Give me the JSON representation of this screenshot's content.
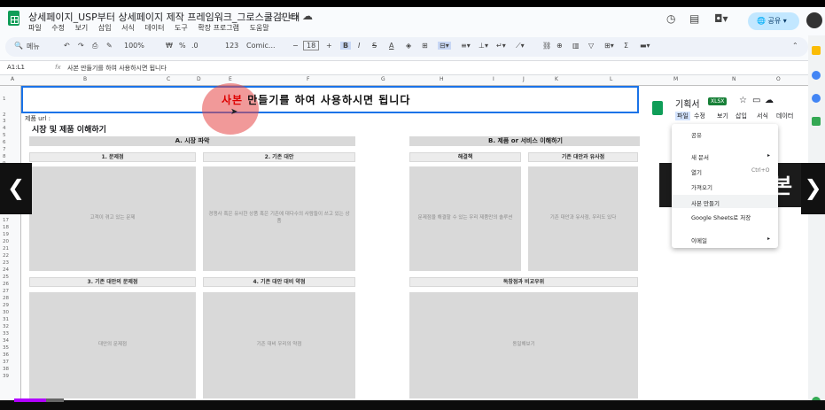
{
  "app": {
    "doc_title": "상세페이지_USP부터 상세페이지 제작 프레임워크_그로스쿨김민태",
    "menus": [
      "파일",
      "수정",
      "보기",
      "삽입",
      "서식",
      "데이터",
      "도구",
      "확장 프로그램",
      "도움말"
    ],
    "share_label": "공유"
  },
  "toolbar": {
    "search_label": "메뉴",
    "zoom": "100%",
    "currency": "₩",
    "percent": "%",
    "decimals": ".0",
    "number_format": "123",
    "font": "Comic...",
    "font_size": "18"
  },
  "formula_bar": {
    "cell_ref": "A1:L1",
    "fx": "fx",
    "content": "사본 만들기를 하여 사용하시면 됩니다"
  },
  "columns": [
    "A",
    "B",
    "C",
    "D",
    "E",
    "F",
    "G",
    "H",
    "I",
    "J",
    "K",
    "L",
    "M",
    "N",
    "O"
  ],
  "rows": [
    "1",
    "2",
    "3",
    "4",
    "5",
    "6",
    "7",
    "8",
    "9",
    "10",
    "11",
    "12",
    "13",
    "14",
    "15",
    "16",
    "17",
    "18",
    "19",
    "20",
    "21",
    "22",
    "23",
    "24",
    "25",
    "26",
    "27",
    "28",
    "29",
    "30",
    "31",
    "32",
    "33",
    "34",
    "35",
    "36",
    "37",
    "38",
    "39"
  ],
  "sheet": {
    "title_accent": "사본",
    "title_rest": " 만들기를 하여 사용하시면 됩니다",
    "page_url_label": "제품 url :",
    "section_title": "시장 및 제품 이해하기",
    "sectionA": "A. 시장 파악",
    "sectionB": "B. 제품 or 서비스 이해하기",
    "a1": "1. 문제점",
    "a2": "2. 기존 대안",
    "a3": "3. 기존 대안의 문제점",
    "a4": "4. 기존 대안 대비 약점",
    "a1_hint": "고객이 겪고 있는 문제",
    "a2_hint": "경쟁사 혹은 유사한 상품 혹은 기존에 대다수의 사람들이 쓰고 있는 상품",
    "a3_hint": "대안의 문제점",
    "a4_hint": "기존 대비 우리의 약점",
    "b1": "해결책",
    "b2": "기존 대안과 유사점",
    "b3": "독창점과 비교우위",
    "b1_hint": "문제점을 해결할 수 있는 우리 제품만의 솔루션",
    "b2_hint": "기존 대안과 유사점, 우리도 있다",
    "b3_hint": "동일해보기"
  },
  "side": {
    "title": "기획서",
    "badge": "XLSX",
    "menus": [
      "파일",
      "수정",
      "보기",
      "삽입",
      "서식",
      "데이터"
    ],
    "big_text": "본",
    "dropdown": [
      "공유",
      "새 문서",
      "열기",
      "가져오기",
      "사본 만들기",
      "Google Sheets로 저장",
      "이메일"
    ],
    "shortcut_open": "Ctrl+O"
  },
  "nav": {
    "prev": "❮",
    "next": "❯"
  },
  "progress": {
    "played": 0.04
  }
}
